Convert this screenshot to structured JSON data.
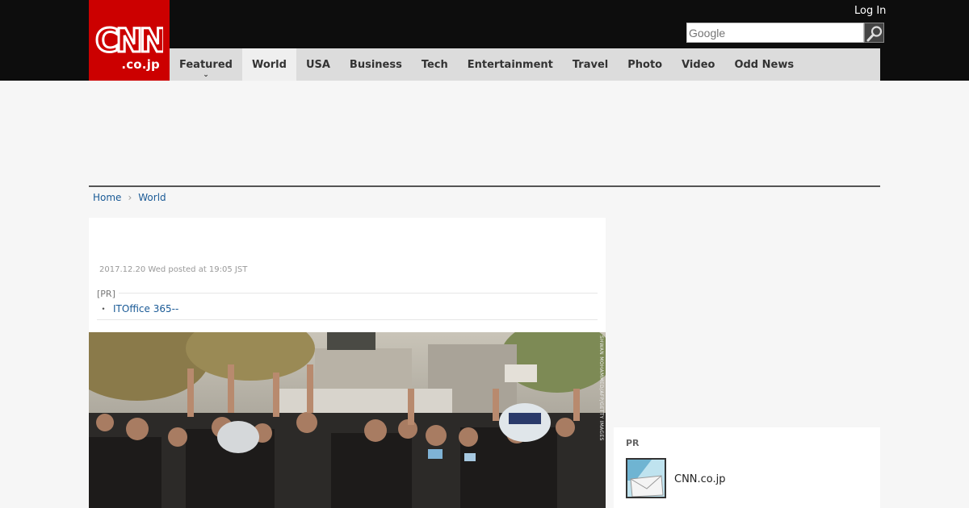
{
  "header": {
    "logo_main": "CNN",
    "logo_domain": ".co.jp",
    "login_label": "Log In",
    "search_placeholder": "Google"
  },
  "nav": {
    "items": [
      {
        "label": "Featured"
      },
      {
        "label": "World"
      },
      {
        "label": "USA"
      },
      {
        "label": "Business"
      },
      {
        "label": "Tech"
      },
      {
        "label": "Entertainment"
      },
      {
        "label": "Travel"
      },
      {
        "label": "Photo"
      },
      {
        "label": "Video"
      },
      {
        "label": "Odd News"
      }
    ],
    "active": "World"
  },
  "breadcrumb": {
    "home": "Home",
    "current": "World"
  },
  "article": {
    "posted": "2017.12.20 Wed posted at 19:05 JST",
    "pr_label": "[PR]",
    "pr_link": "ITOffice 365--",
    "photo_credit": "SHWAN MOHAMMED/AFP/GETTY IMAGES"
  },
  "sidebar": {
    "pr_label": "PR",
    "pr_item_title": "CNN.co.jp"
  },
  "colors": {
    "brand_red": "#cc0000",
    "topbar": "#0d0d0d",
    "nav_bg": "#dcdcdc",
    "link": "#1a5a96"
  }
}
